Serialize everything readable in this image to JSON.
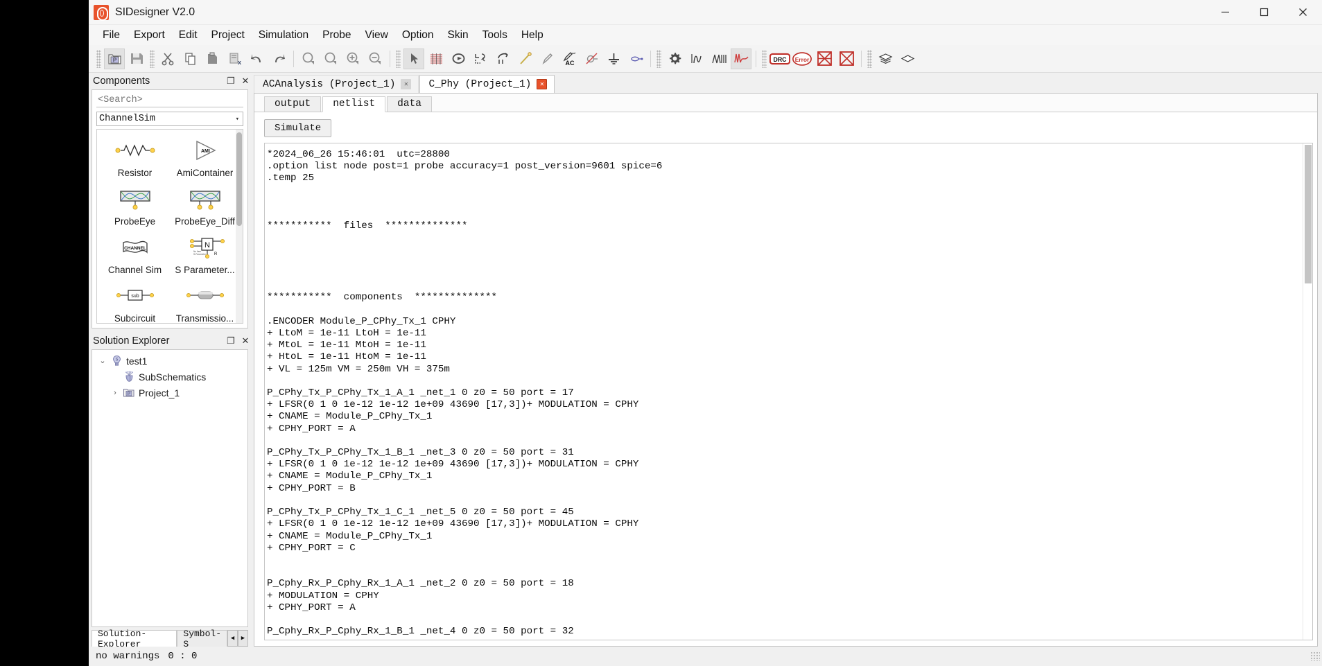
{
  "window": {
    "title": "SIDesigner V2.0",
    "logo_color": "#e8522b",
    "controls": {
      "minimize": "—",
      "maximize": "☐",
      "close": "✕"
    }
  },
  "menubar": {
    "items": [
      "File",
      "Export",
      "Edit",
      "Project",
      "Simulation",
      "Probe",
      "View",
      "Option",
      "Skin",
      "Tools",
      "Help"
    ]
  },
  "toolbar": {
    "groups": [
      {
        "items": [
          {
            "name": "new-project-icon",
            "glyph": "P"
          },
          {
            "name": "save-icon",
            "glyph": "save"
          }
        ]
      },
      {
        "items": [
          {
            "name": "cut-icon",
            "glyph": "cut"
          },
          {
            "name": "copy-icon",
            "glyph": "copy"
          },
          {
            "name": "paste-icon",
            "glyph": "paste"
          },
          {
            "name": "delete-icon",
            "glyph": "delete"
          },
          {
            "name": "undo-icon",
            "glyph": "undo"
          },
          {
            "name": "redo-icon",
            "glyph": "redo"
          }
        ]
      },
      {
        "items": [
          {
            "name": "zoom-fit-icon",
            "glyph": "zoomfit"
          },
          {
            "name": "zoom-selection-icon",
            "glyph": "zoomsel"
          },
          {
            "name": "zoom-in-icon",
            "glyph": "zoomin"
          },
          {
            "name": "zoom-out-icon",
            "glyph": "zoomout"
          }
        ]
      },
      {
        "items": [
          {
            "name": "select-pointer-icon",
            "glyph": "pointer"
          },
          {
            "name": "grid-icon",
            "glyph": "grid"
          },
          {
            "name": "rotate-icon",
            "glyph": "rotate"
          },
          {
            "name": "align-icon",
            "glyph": "align"
          },
          {
            "name": "mirror-icon",
            "glyph": "mirror"
          },
          {
            "name": "wire-icon",
            "glyph": "wire"
          },
          {
            "name": "pin-icon",
            "glyph": "pin"
          },
          {
            "name": "ac-source-icon",
            "glyph": "ac"
          },
          {
            "name": "no-connect-icon",
            "glyph": "noconn"
          },
          {
            "name": "ground-icon",
            "glyph": "ground"
          },
          {
            "name": "port-icon",
            "glyph": "port"
          }
        ]
      },
      {
        "items": [
          {
            "name": "settings-gear-icon",
            "glyph": "gear"
          },
          {
            "name": "waveform-single-icon",
            "glyph": "wave1"
          },
          {
            "name": "waveform-multi-icon",
            "glyph": "wave2"
          },
          {
            "name": "waveform-red-icon",
            "glyph": "wave3"
          }
        ]
      },
      {
        "items": [
          {
            "name": "drc-icon",
            "glyph": "DRC"
          },
          {
            "name": "error-icon",
            "glyph": "Error"
          },
          {
            "name": "clear-errors-icon",
            "glyph": "xbox1"
          },
          {
            "name": "clear-all-icon",
            "glyph": "xbox2"
          }
        ]
      },
      {
        "items": [
          {
            "name": "layers-icon",
            "glyph": "layers"
          },
          {
            "name": "single-layer-icon",
            "glyph": "layer1"
          }
        ]
      }
    ]
  },
  "components_panel": {
    "title": "Components",
    "float_button": "❐",
    "close_button": "✕",
    "search": {
      "value": "",
      "placeholder": "<Search>"
    },
    "category": {
      "value": "ChannelSim",
      "arrow": "▾"
    },
    "items": [
      {
        "label": "Resistor",
        "icon": "resistor-symbol"
      },
      {
        "label": "AmiContainer",
        "icon": "ami-symbol"
      },
      {
        "label": "ProbeEye",
        "icon": "probe-eye-symbol"
      },
      {
        "label": "ProbeEye_Diff",
        "icon": "probe-eye-diff-symbol"
      },
      {
        "label": "Channel Sim",
        "icon": "channel-symbol"
      },
      {
        "label": "S Parameter...",
        "icon": "s-parameter-symbol"
      },
      {
        "label": "Subcircuit",
        "icon": "subcircuit-symbol"
      },
      {
        "label": "Transmissio...",
        "icon": "transmission-line-symbol"
      }
    ]
  },
  "solution_explorer": {
    "title": "Solution Explorer",
    "float_button": "❐",
    "close_button": "✕",
    "tree": [
      {
        "label": "test1",
        "twisty": "⌄",
        "icon": "solution-icon",
        "indent": 0
      },
      {
        "label": "SubSchematics",
        "twisty": "",
        "icon": "subschematics-icon",
        "indent": 1
      },
      {
        "label": "Project_1",
        "twisty": "›",
        "icon": "project-folder-icon",
        "indent": 1
      }
    ],
    "dock_tabs": [
      {
        "label": "Solution-Explorer",
        "active": true
      },
      {
        "label": "Symbol-S",
        "active": false
      }
    ],
    "dock_nav": {
      "prev": "◀",
      "next": "▶"
    }
  },
  "document_tabs": [
    {
      "label": "ACAnalysis (Project_1)",
      "active": false,
      "close": "✕",
      "close_style": "grey"
    },
    {
      "label": "C_Phy (Project_1)",
      "active": true,
      "close": "✕",
      "close_style": "red"
    }
  ],
  "sub_tabs": [
    {
      "label": "output",
      "active": false
    },
    {
      "label": "netlist",
      "active": true
    },
    {
      "label": "data",
      "active": false
    }
  ],
  "simulate_button": {
    "label": "Simulate"
  },
  "netlist": {
    "text": "*2024_06_26 15:46:01  utc=28800\n.option list node post=1 probe accuracy=1 post_version=9601 spice=6\n.temp 25\n\n\n\n***********  files  **************\n\n\n\n\n\n***********  components  **************\n\n.ENCODER Module_P_CPhy_Tx_1 CPHY\n+ LtoM = 1e-11 LtoH = 1e-11\n+ MtoL = 1e-11 MtoH = 1e-11\n+ HtoL = 1e-11 HtoM = 1e-11\n+ VL = 125m VM = 250m VH = 375m\n\nP_CPhy_Tx_P_CPhy_Tx_1_A_1 _net_1 0 z0 = 50 port = 17\n+ LFSR(0 1 0 1e-12 1e-12 1e+09 43690 [17,3])+ MODULATION = CPHY\n+ CNAME = Module_P_CPhy_Tx_1\n+ CPHY_PORT = A\n\nP_CPhy_Tx_P_CPhy_Tx_1_B_1 _net_3 0 z0 = 50 port = 31\n+ LFSR(0 1 0 1e-12 1e-12 1e+09 43690 [17,3])+ MODULATION = CPHY\n+ CNAME = Module_P_CPhy_Tx_1\n+ CPHY_PORT = B\n\nP_CPhy_Tx_P_CPhy_Tx_1_C_1 _net_5 0 z0 = 50 port = 45\n+ LFSR(0 1 0 1e-12 1e-12 1e+09 43690 [17,3])+ MODULATION = CPHY\n+ CNAME = Module_P_CPhy_Tx_1\n+ CPHY_PORT = C\n\n\nP_Cphy_Rx_P_Cphy_Rx_1_A_1 _net_2 0 z0 = 50 port = 18\n+ MODULATION = CPHY\n+ CPHY_PORT = A\n\nP_Cphy_Rx_P_Cphy_Rx_1_B_1 _net_4 0 z0 = 50 port = 32"
  },
  "statusbar": {
    "warnings": "no warnings",
    "position": "0 : 0"
  }
}
